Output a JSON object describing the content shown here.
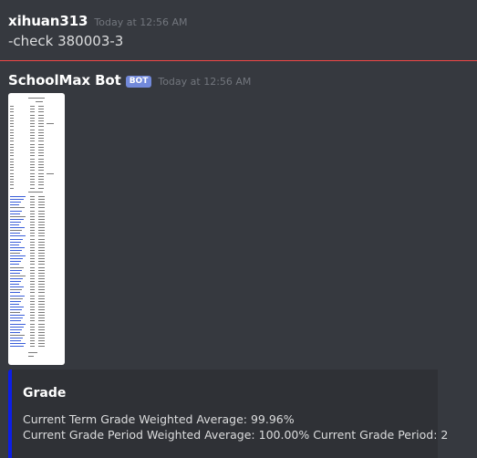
{
  "messages": [
    {
      "username": "xihuan313",
      "timestamp": "Today at 12:56 AM",
      "content": "-check 380003-3"
    },
    {
      "username": "SchoolMax Bot",
      "badge": "BOT",
      "timestamp": "Today at 12:56 AM"
    }
  ],
  "embed": {
    "title": "Grade",
    "lines": [
      "Current Term Grade Weighted Average: 99.96%",
      "Current Grade Period Weighted Average: 100.00% Current Grade Period: 2"
    ],
    "accent_color": "#0c1ee8"
  },
  "colors": {
    "background": "#36393f",
    "divider": "#f04747",
    "badge": "#7289da",
    "embed_background": "#2f3136"
  }
}
